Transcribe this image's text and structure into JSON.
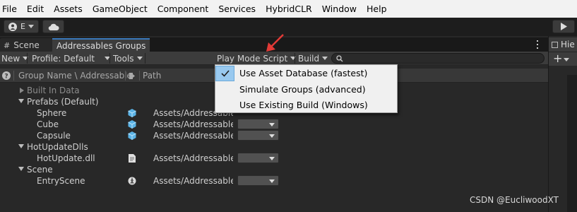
{
  "menu": [
    "File",
    "Edit",
    "Assets",
    "GameObject",
    "Component",
    "Services",
    "HybridCLR",
    "Window",
    "Help"
  ],
  "toolbar": {
    "account_label": "E"
  },
  "tabs": {
    "scene": "Scene",
    "addressables": "Addressables Groups",
    "hierarchy": "Hie"
  },
  "groups_toolbar": {
    "new": "New",
    "profile": "Profile: Default",
    "tools": "Tools",
    "play_mode": "Play Mode Script",
    "build": "Build"
  },
  "columns": {
    "name": "Group Name \\ Addressable",
    "path": "Path"
  },
  "tree": [
    {
      "label": "Built In Data"
    },
    {
      "label": "Prefabs (Default)"
    },
    {
      "label": "Sphere",
      "path": "Assets/Addressables/"
    },
    {
      "label": "Cube",
      "path": "Assets/Addressables/"
    },
    {
      "label": "Capsule",
      "path": "Assets/Addressables/"
    },
    {
      "label": "HotUpdateDlls"
    },
    {
      "label": "HotUpdate.dll",
      "path": "Assets/Addressables/"
    },
    {
      "label": "Scene"
    },
    {
      "label": "EntryScene",
      "path": "Assets/Addressables/"
    }
  ],
  "popup": {
    "items": [
      "Use Asset Database (fastest)",
      "Simulate Groups (advanced)",
      "Use Existing Build (Windows)"
    ],
    "selected": 0
  },
  "colors": {
    "accent": "#3a79bb",
    "arrow": "#e23a36",
    "menu_bg": "#f2f2f2"
  },
  "watermark": "CSDN @EucliwoodXT"
}
